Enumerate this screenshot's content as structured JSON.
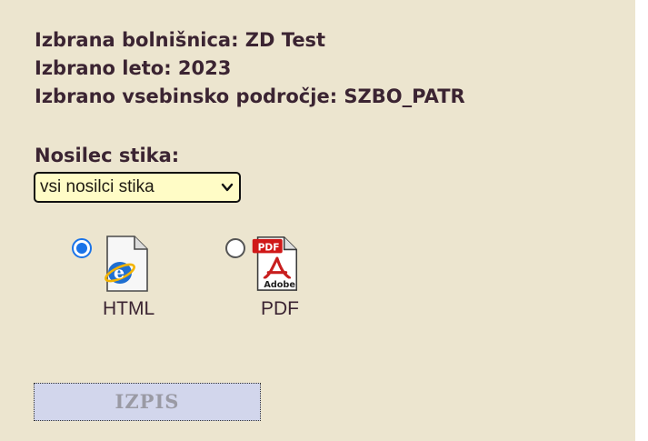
{
  "info": {
    "hospital": "Izbrana bolnišnica: ZD Test",
    "year": "Izbrano leto: 2023",
    "area": "Izbrano vsebinsko področje: SZBO_PATR"
  },
  "carrier": {
    "label": "Nosilec stika:",
    "selected_value": "vsi nosilci stika"
  },
  "formats": {
    "options": [
      {
        "label": "HTML",
        "icon": "html-file-icon",
        "selected": true
      },
      {
        "label": "PDF",
        "icon": "pdf-file-icon",
        "selected": false
      }
    ],
    "pdf_badge": "PDF",
    "pdf_vendor": "Adobe"
  },
  "actions": {
    "print_label": "IZPIS"
  },
  "colors": {
    "panel_bg": "#ece5cf",
    "text": "#3b2432",
    "select_bg": "#fffcc6",
    "radio_accent": "#1a73e8",
    "button_bg": "#d2d6ec",
    "button_text": "#9a9aa4"
  }
}
